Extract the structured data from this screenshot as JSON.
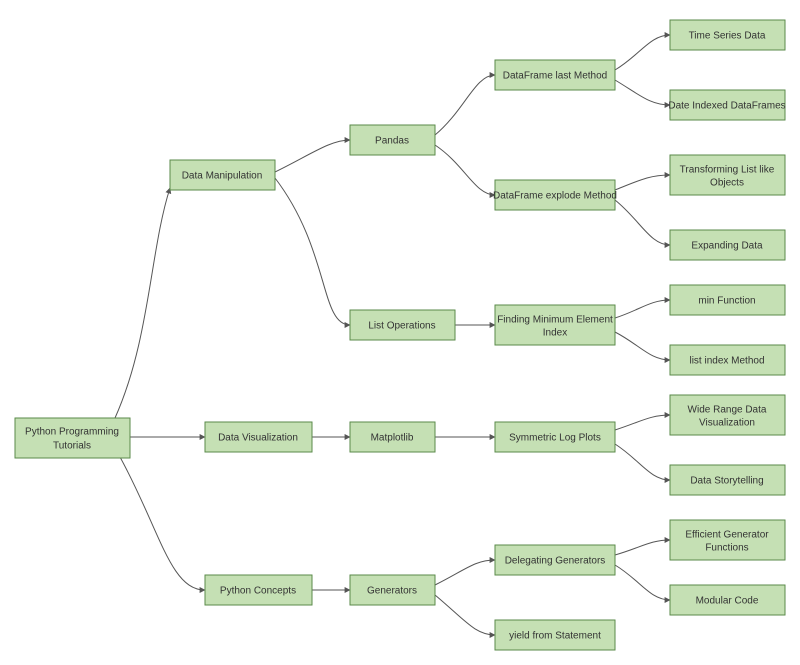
{
  "nodes": {
    "root": "Python Programming Tutorials",
    "dataManipulation": "Data Manipulation",
    "dataVisualization": "Data Visualization",
    "pythonConcepts": "Python Concepts",
    "pandas": "Pandas",
    "listOperations": "List Operations",
    "matplotlib": "Matplotlib",
    "generators": "Generators",
    "dfLast": "DataFrame last Method",
    "dfExplode": "DataFrame explode Method",
    "findMinIdx": "Finding Minimum Element Index",
    "symLog": "Symmetric Log Plots",
    "delegGen": "Delegating Generators",
    "yieldFrom": "yield from Statement",
    "timeSeries": "Time Series Data",
    "dateIdx": "Date Indexed DataFrames",
    "transformList": "Transforming List like Objects",
    "expandData": "Expanding Data",
    "minFunc": "min Function",
    "listIdx": "list index Method",
    "wideRange": "Wide Range Data Visualization",
    "dataStory": "Data Storytelling",
    "effGen": "Efficient Generator Functions",
    "modCode": "Modular Code"
  }
}
